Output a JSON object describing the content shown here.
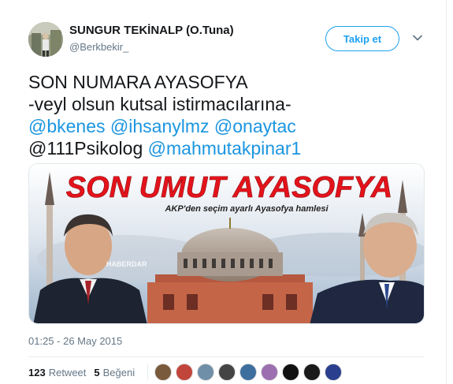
{
  "user": {
    "display_name": "SUNGUR TEKİNALP (O.Tuna)",
    "handle": "@Berkbekir_",
    "follow_label": "Takip et"
  },
  "tweet": {
    "line1": "SON NUMARA AYASOFYA",
    "line2": "-veyl olsun kutsal istirmacılarına-",
    "mentions": [
      "@bkenes",
      "@ihsanylmz",
      "@onaytac",
      "@111Psikolog",
      "@mahmutakpinar1"
    ],
    "timestamp": "01:25 - 26 May 2015"
  },
  "media": {
    "headline": "SON UMUT AYASOFYA",
    "subheadline": "AKP'den seçim ayarlı Ayasofya hamlesi",
    "watermark": "HABERDAR"
  },
  "stats": {
    "retweet_count": "123",
    "retweet_label": "Retweet",
    "like_count": "5",
    "like_label": "Beğeni"
  },
  "likers": [
    "#7a5a3c",
    "#c2453b",
    "#6f8fa8",
    "#444444",
    "#3d6e9e",
    "#9b6fb0",
    "#111111",
    "#1a1a1a",
    "#2b3f8f"
  ],
  "colors": {
    "accent": "#1da1f2",
    "mention": "#1b95e0",
    "headline_red": "#e4131b"
  }
}
